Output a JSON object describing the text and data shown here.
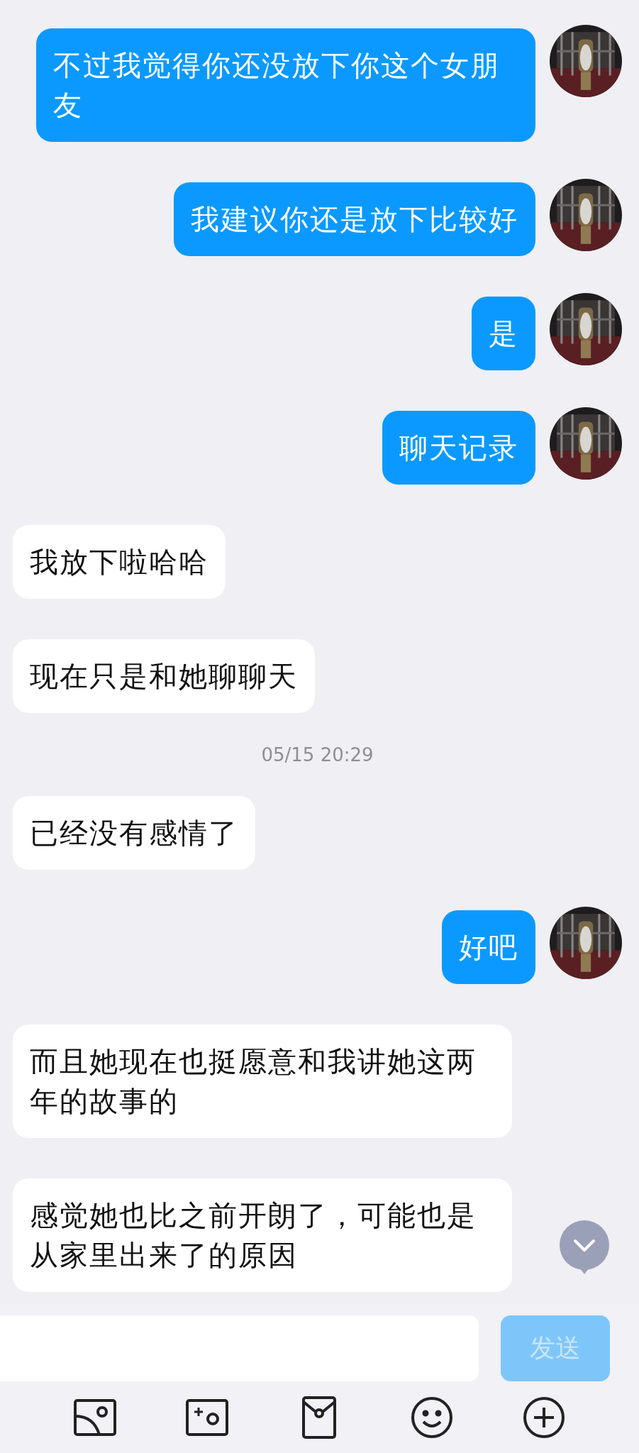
{
  "messages": [
    {
      "kind": "sent",
      "text": "不过我觉得你还没放下你这个女朋友"
    },
    {
      "kind": "sent",
      "text": "我建议你还是放下比较好"
    },
    {
      "kind": "sent",
      "text": "是"
    },
    {
      "kind": "sent",
      "text": "聊天记录"
    },
    {
      "kind": "received",
      "text": "我放下啦哈哈"
    },
    {
      "kind": "received",
      "text": "现在只是和她聊聊天"
    },
    {
      "kind": "time",
      "text": "05/15 20:29"
    },
    {
      "kind": "received",
      "text": "已经没有感情了"
    },
    {
      "kind": "sent",
      "text": "好吧"
    },
    {
      "kind": "received",
      "text": "而且她现在也挺愿意和我讲她这两年的故事的"
    },
    {
      "kind": "received",
      "text": "感觉她也比之前开朗了，可能也是从家里出来了的原因"
    }
  ],
  "composer": {
    "send_button": {
      "label": "发送",
      "disabled": true
    }
  }
}
